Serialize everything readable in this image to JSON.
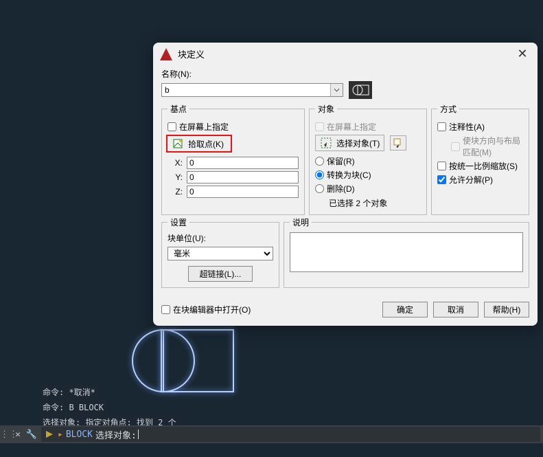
{
  "dialog": {
    "title": "块定义",
    "name_label": "名称(N):",
    "name_value": "b"
  },
  "base_point": {
    "legend": "基点",
    "on_screen": "在屏幕上指定",
    "pick_label": "拾取点(K)",
    "x_label": "X:",
    "x_val": "0",
    "y_label": "Y:",
    "y_val": "0",
    "z_label": "Z:",
    "z_val": "0"
  },
  "objects": {
    "legend": "对象",
    "on_screen": "在屏幕上指定",
    "select_label": "选择对象(T)",
    "retain": "保留(R)",
    "convert": "转换为块(C)",
    "delete": "删除(D)",
    "selected_text": "已选择 2 个对象"
  },
  "mode": {
    "legend": "方式",
    "annotative": "注释性(A)",
    "orient": "使块方向与布局匹配(M)",
    "scale_uniform": "按统一比例缩放(S)",
    "allow_explode": "允许分解(P)"
  },
  "settings": {
    "legend": "设置",
    "unit_label": "块单位(U):",
    "unit_value": "毫米",
    "hyperlink": "超链接(L)..."
  },
  "description": {
    "legend": "说明",
    "value": ""
  },
  "bottom": {
    "open_editor": "在块编辑器中打开(O)",
    "ok": "确定",
    "cancel": "取消",
    "help": "帮助(H)"
  },
  "cmd_history": [
    "命令: *取消*",
    "命令: B  BLOCK",
    "选择对象: 指定对角点: 找到 2 个"
  ],
  "cmd_prompt": {
    "keyword": "BLOCK",
    "text": "选择对象:"
  }
}
